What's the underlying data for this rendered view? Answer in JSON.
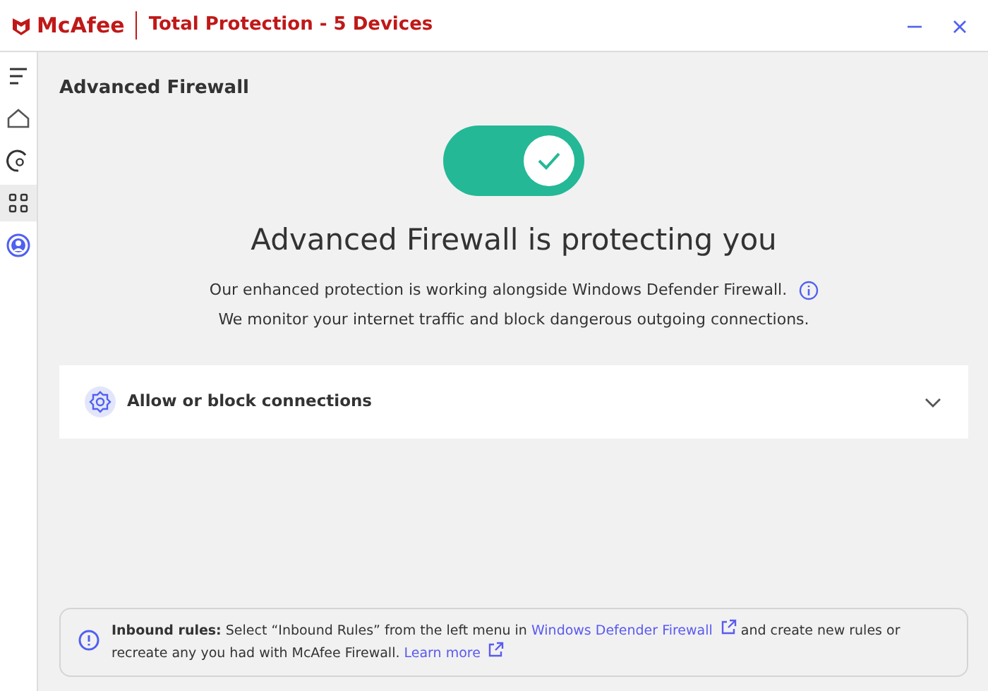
{
  "window": {
    "brand": "McAfee",
    "title": "Total Protection - 5 Devices"
  },
  "sidebar": {
    "items": [
      {
        "kind": "menu",
        "selected": false
      },
      {
        "kind": "home",
        "selected": false
      },
      {
        "kind": "gauge",
        "selected": false
      },
      {
        "kind": "apps",
        "selected": true
      },
      {
        "kind": "account",
        "selected": false
      }
    ]
  },
  "page_title": "Advanced Firewall",
  "toggle": {
    "on": true
  },
  "status": {
    "heading": "Advanced Firewall is protecting you",
    "lines": [
      "Our enhanced protection is working alongside Windows Defender Firewall.",
      "We monitor your internet traffic and block dangerous outgoing connections."
    ]
  },
  "expander": {
    "label": "Allow or block connections",
    "expanded": false
  },
  "notice": {
    "parts": [
      {
        "kind": "bold",
        "text": "Inbound rules:"
      },
      {
        "kind": "text",
        "text": " Select “Inbound Rules” from the left menu in "
      },
      {
        "kind": "link",
        "text": "Windows Defender Firewall"
      },
      {
        "kind": "text",
        "text": " and create new rules or recreate any you had with McAfee Firewall. "
      },
      {
        "kind": "link",
        "text": "Learn more"
      }
    ]
  }
}
